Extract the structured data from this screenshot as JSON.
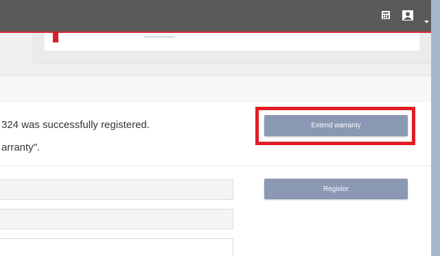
{
  "success": {
    "line1": "324 was successfully registered.",
    "line2": "arranty\"."
  },
  "actions": {
    "extend_label": "Extend warranty",
    "register_label": "Register"
  },
  "colors": {
    "topbar": "#5a5a5a",
    "accent_red": "#d6202c",
    "button": "#8a98b4"
  },
  "icons": {
    "topbar": [
      "calculator-icon",
      "user-icon",
      "caret-down-icon"
    ]
  }
}
